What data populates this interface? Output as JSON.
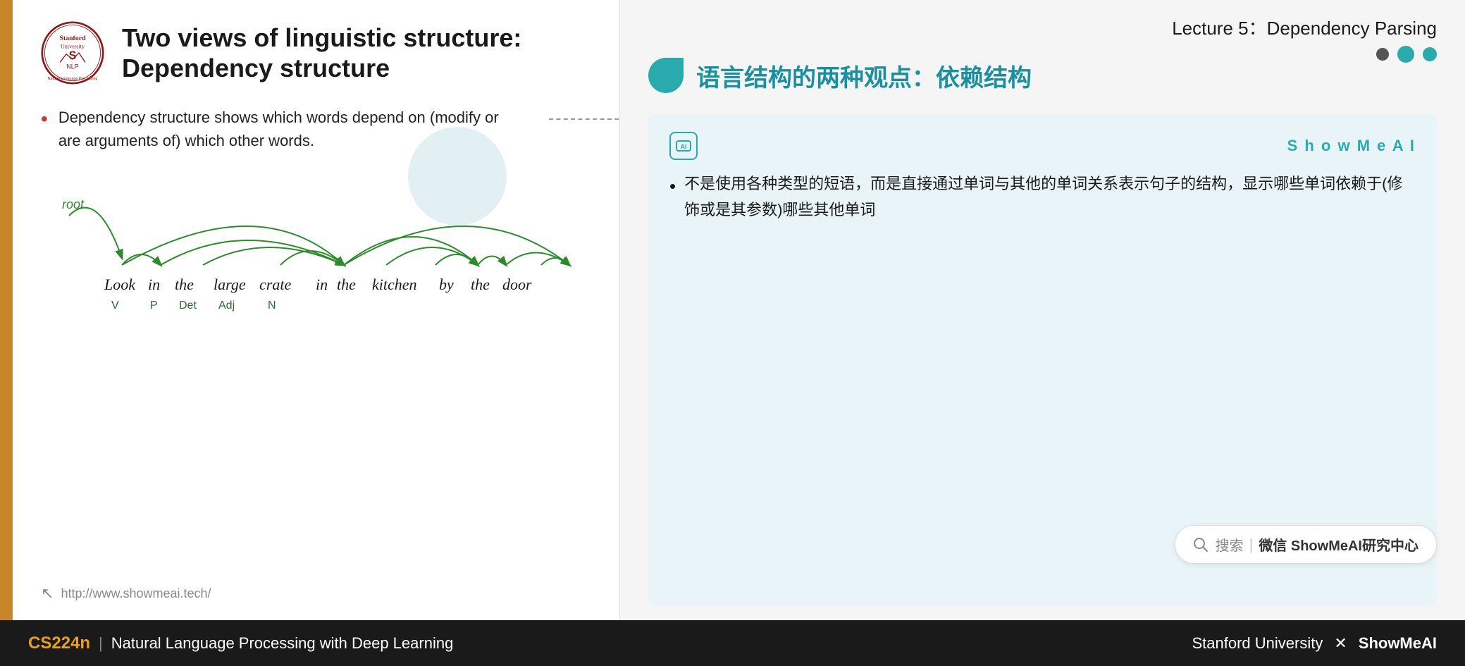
{
  "lecture": {
    "title": "Lecture 5：Dependency Parsing"
  },
  "slide": {
    "title_line1": "Two views of linguistic structure:",
    "title_line2": "Dependency structure",
    "bullet": "Dependency structure shows which words depend on (modify or are arguments of) which other words.",
    "footer_url": "http://www.showmeai.tech/",
    "sentence_words": [
      "Look",
      "in",
      "the",
      "large",
      "crate",
      "in",
      "the",
      "kitchen",
      "by",
      "the",
      "door"
    ],
    "sentence_labels": [
      "V",
      "P",
      "Det",
      "Adj",
      "N",
      "",
      "",
      "",
      "",
      "",
      ""
    ],
    "root_label": "root"
  },
  "right_panel": {
    "chinese_title": "语言结构的两种观点：依赖结构",
    "ai_icon_label": "AI",
    "showmeai_label": "S h o w M e A I",
    "chinese_bullet": "不是使用各种类型的短语，而是直接通过单词与其他的单词关系表示句子的结构，显示哪些单词依赖于(修饰或是其参数)哪些其他单词",
    "nav_dots": [
      "inactive",
      "active",
      "inactive"
    ]
  },
  "search": {
    "placeholder": "搜索 | 微信 ShowMeAI研究中心"
  },
  "bottom_bar": {
    "course_code": "CS224n",
    "divider": "|",
    "course_name": "Natural Language Processing with Deep Learning",
    "right_text": "Stanford University",
    "x_separator": "✕",
    "brand": "ShowMeAI"
  }
}
